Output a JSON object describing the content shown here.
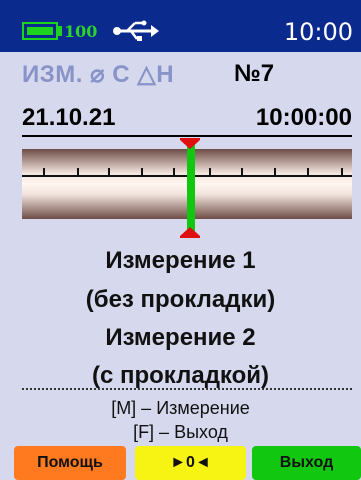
{
  "status": {
    "battery": "100",
    "clock": "10:00"
  },
  "mode": {
    "label": "ИЗМ. ⌀ C △H",
    "number": "№7"
  },
  "datetime": {
    "date": "21.10.21",
    "time": "10:00:00"
  },
  "messages": [
    "Измерение 1",
    "(без прокладки)",
    "Измерение 2",
    "(с прокладкой)"
  ],
  "hints": [
    "[M] – Измерение",
    "[F] – Выход"
  ],
  "softkeys": {
    "help": "Помощь",
    "zero": "►0◄",
    "exit": "Выход"
  },
  "colors": {
    "status_bar": "#0a2a8e",
    "screen_bg": "#d6d8ee",
    "help_key": "#ff7a1f",
    "zero_key": "#f7f313",
    "exit_key": "#12c70f",
    "indicator": "#3ad11a",
    "marker": "#e01010"
  }
}
